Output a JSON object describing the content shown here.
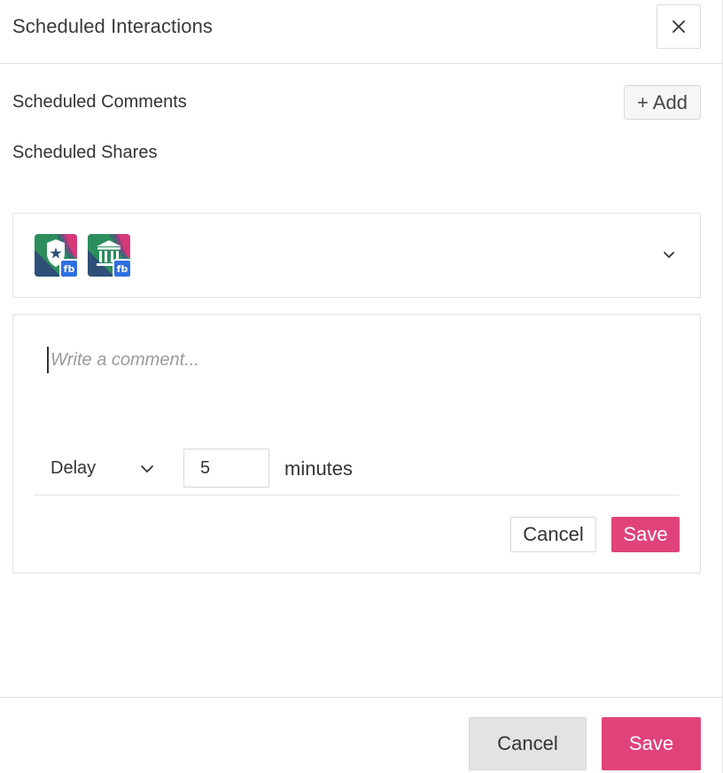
{
  "header": {
    "title": "Scheduled Interactions",
    "close_icon": "close-icon"
  },
  "sections": {
    "comments_label": "Scheduled Comments",
    "add_label": "+ Add",
    "shares_label": "Scheduled Shares"
  },
  "accounts": {
    "items": [
      {
        "icon": "police-badge-avatar",
        "badge": "fb"
      },
      {
        "icon": "courthouse-avatar",
        "badge": "fb"
      }
    ],
    "expand_icon": "chevron-down-icon"
  },
  "comment_form": {
    "placeholder": "Write a comment...",
    "value": "",
    "delay_select": {
      "selected": "Delay",
      "icon": "chevron-down-icon"
    },
    "minutes_value": "5",
    "minutes_label": "minutes",
    "cancel_label": "Cancel",
    "save_label": "Save"
  },
  "footer": {
    "cancel_label": "Cancel",
    "save_label": "Save"
  },
  "colors": {
    "accent": "#e0437a",
    "facebook_badge": "#2f6fe0",
    "border": "#e1e1e1"
  }
}
